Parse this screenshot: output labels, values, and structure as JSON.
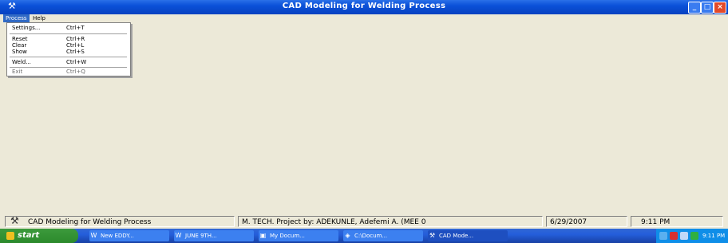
{
  "window": {
    "title": "CAD Modeling for Welding Process",
    "app_icon": "welder-icon",
    "buttons": {
      "minimize": "_",
      "maximize": "□",
      "close": "×"
    }
  },
  "menubar": {
    "items": [
      {
        "label": "Process"
      },
      {
        "label": "Help"
      }
    ]
  },
  "dropdown": {
    "items": [
      {
        "label": "Settings...",
        "shortcut": "Ctrl+T"
      },
      {
        "label": "Reset",
        "shortcut": "Ctrl+R"
      },
      {
        "label": "Clear",
        "shortcut": "Ctrl+L"
      },
      {
        "label": "Show",
        "shortcut": "Ctrl+S"
      },
      {
        "label": "Weld...",
        "shortcut": "Ctrl+W"
      },
      {
        "label": "Exit",
        "shortcut": "Ctrl+Q"
      }
    ]
  },
  "statusbar": {
    "app_name": "CAD Modeling for Welding Process",
    "project": "M. TECH. Project by: ADEKUNLE, Adefemi A. (MEE 0",
    "date": "6/29/2007",
    "time": "9:11 PM"
  },
  "taskbar": {
    "start_label": "start",
    "tasks": [
      {
        "label": "New EDDY...",
        "icon": "word-icon"
      },
      {
        "label": "JUNE 9TH...",
        "icon": "word-icon"
      },
      {
        "label": "My Docum...",
        "icon": "folder-icon"
      },
      {
        "label": "C:\\Docum...",
        "icon": "explorer-icon"
      },
      {
        "label": "CAD Mode...",
        "icon": "welder-icon"
      }
    ],
    "tray_icons": [
      "network-icon",
      "antivirus-icon",
      "speaker-icon",
      "security-icon"
    ],
    "clock": "9:11 PM"
  }
}
